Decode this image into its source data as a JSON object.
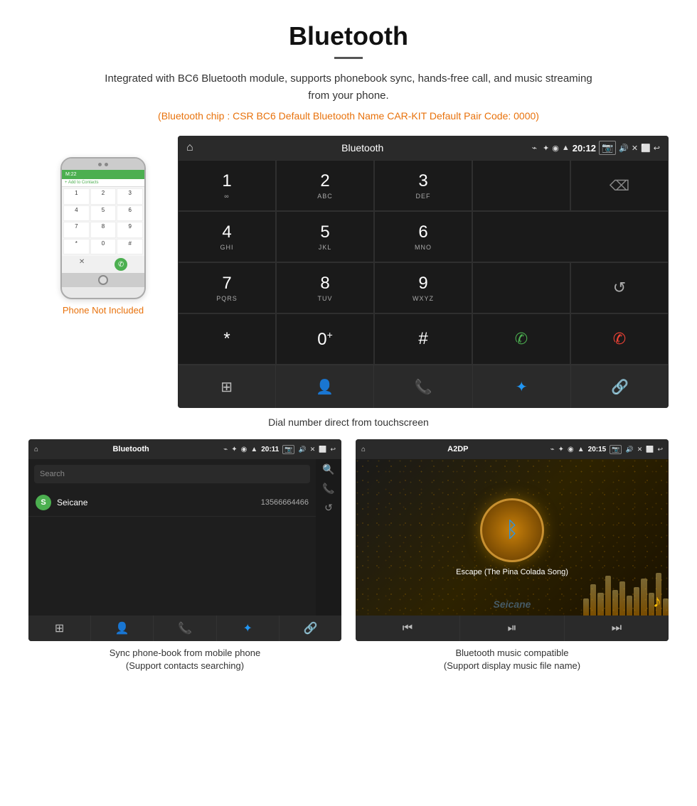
{
  "header": {
    "title": "Bluetooth",
    "description": "Integrated with BC6 Bluetooth module, supports phonebook sync, hands-free call, and music streaming from your phone.",
    "specs": "(Bluetooth chip : CSR BC6   Default Bluetooth Name CAR-KIT    Default Pair Code: 0000)"
  },
  "phone_label": "Phone Not Included",
  "car_screen": {
    "statusbar": {
      "title": "Bluetooth",
      "time": "20:12",
      "usb_icon": "⌁",
      "home_icon": "⌂"
    },
    "dialpad": [
      {
        "key": "1",
        "sub": "∞"
      },
      {
        "key": "2",
        "sub": "ABC"
      },
      {
        "key": "3",
        "sub": "DEF"
      },
      {
        "key": "",
        "sub": ""
      },
      {
        "key": "⌫",
        "sub": ""
      },
      {
        "key": "4",
        "sub": "GHI"
      },
      {
        "key": "5",
        "sub": "JKL"
      },
      {
        "key": "6",
        "sub": "MNO"
      },
      {
        "key": "",
        "sub": ""
      },
      {
        "key": "",
        "sub": ""
      },
      {
        "key": "7",
        "sub": "PQRS"
      },
      {
        "key": "8",
        "sub": "TUV"
      },
      {
        "key": "9",
        "sub": "WXYZ"
      },
      {
        "key": "",
        "sub": ""
      },
      {
        "key": "↺",
        "sub": ""
      },
      {
        "key": "*",
        "sub": ""
      },
      {
        "key": "0⁺",
        "sub": ""
      },
      {
        "key": "#",
        "sub": ""
      },
      {
        "key": "📞",
        "sub": ""
      },
      {
        "key": "📵",
        "sub": ""
      }
    ],
    "bottom_icons": [
      "⊞",
      "👤",
      "📞",
      "✦",
      "🔗"
    ]
  },
  "dial_caption": "Dial number direct from touchscreen",
  "phonebook_screen": {
    "statusbar": {
      "title": "Bluetooth",
      "time": "20:11"
    },
    "search_placeholder": "Search",
    "contacts": [
      {
        "initial": "S",
        "name": "Seicane",
        "number": "13566664466"
      }
    ],
    "bottom_icons": [
      "⊞",
      "👤",
      "📞",
      "✦",
      "🔗"
    ]
  },
  "phonebook_caption": "Sync phone-book from mobile phone\n(Support contacts searching)",
  "music_screen": {
    "statusbar": {
      "title": "A2DP",
      "time": "20:15"
    },
    "song_title": "Escape (The Pina Colada Song)",
    "control_icons": [
      "⏮",
      "⏯",
      "⏭"
    ]
  },
  "music_caption": "Bluetooth music compatible\n(Support display music file name)",
  "watermark": "Seicane"
}
